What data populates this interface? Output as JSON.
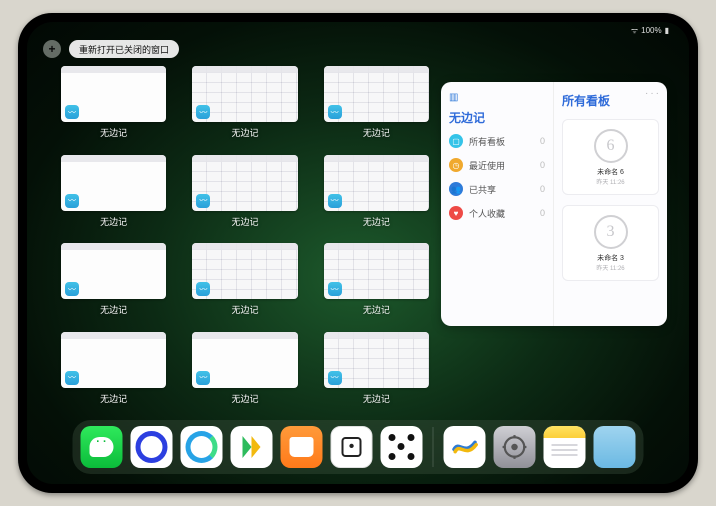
{
  "status": {
    "battery": "100%"
  },
  "topControls": {
    "plus": "+",
    "reopen_label": "重新打开已关闭的窗口"
  },
  "tileLabel": "无边记",
  "tileVariants": [
    "plain",
    "grid",
    "grid",
    "plain",
    "grid",
    "grid",
    "plain",
    "grid",
    "grid",
    "plain",
    "plain",
    "grid"
  ],
  "panel": {
    "more": "···",
    "title": "无边记",
    "rightTitle": "所有看板",
    "categories": [
      {
        "icon_color": "#34c3e8",
        "glyph": "▢",
        "label": "所有看板",
        "count": "0"
      },
      {
        "icon_color": "#f0a92e",
        "glyph": "◷",
        "label": "最近使用",
        "count": "0"
      },
      {
        "icon_color": "#2e7bd9",
        "glyph": "👥",
        "label": "已共享",
        "count": "0"
      },
      {
        "icon_color": "#ee4a46",
        "glyph": "♥",
        "label": "个人收藏",
        "count": "0"
      }
    ],
    "boards": [
      {
        "glyph": "6",
        "name": "未命名 6",
        "sub": "昨天 11:26"
      },
      {
        "glyph": "3",
        "name": "未命名 3",
        "sub": "昨天 11:26"
      }
    ]
  },
  "dock": {
    "items": [
      "wechat",
      "quark",
      "browser",
      "play",
      "books",
      "dice",
      "nodes",
      "freeform",
      "settings",
      "notes",
      "folder"
    ]
  }
}
